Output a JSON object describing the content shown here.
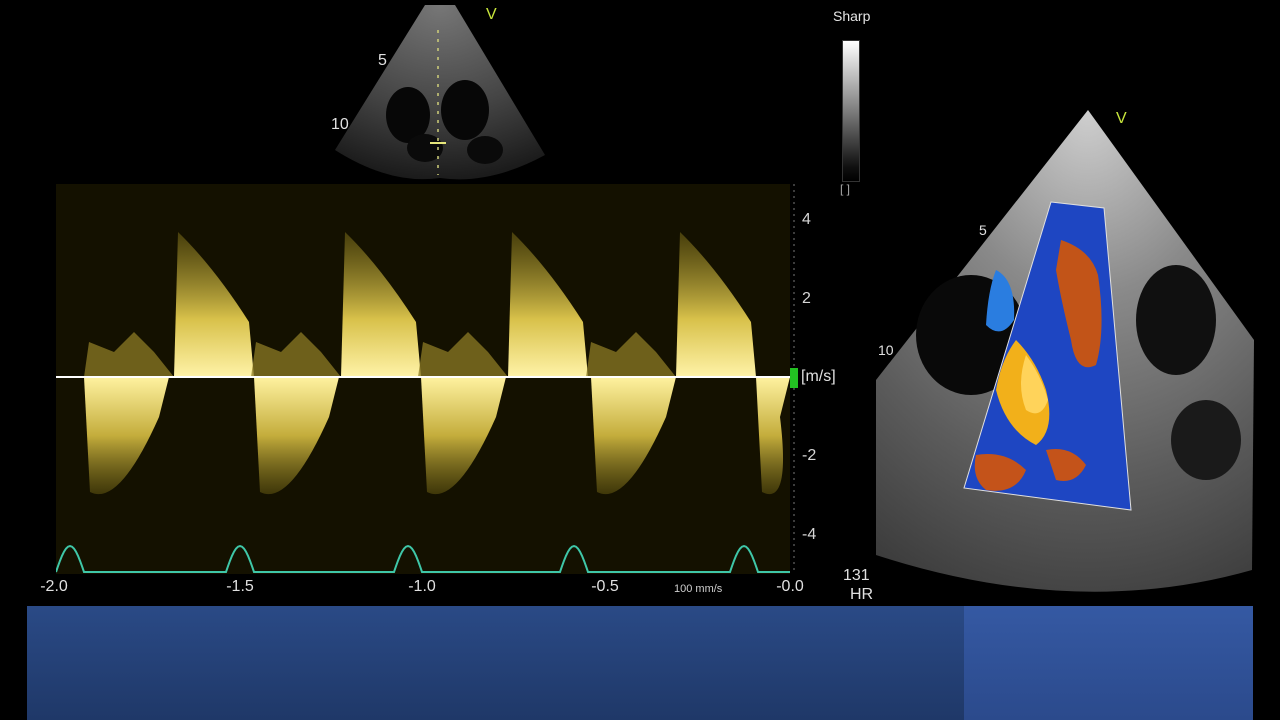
{
  "thumbnail": {
    "depth_marks": [
      "5",
      "10"
    ],
    "orientation_mark": "V"
  },
  "grayscale": {
    "label": "Sharp",
    "bracket": "[ ]"
  },
  "doppler": {
    "velocity_ticks": [
      "4",
      "2",
      "-2",
      "-4"
    ],
    "unit_label": "[m/s]",
    "time_ticks": [
      "-2.0",
      "-1.5",
      "-1.0",
      "-0.5",
      "-0.0"
    ],
    "sweep_speed": "100 mm/s",
    "heart_rate_value": "131",
    "heart_rate_label": "HR",
    "colors": {
      "spectrum": "#f0d85a",
      "ecg": "#3fc7a8",
      "baseline": "#ffffff"
    }
  },
  "color_doppler": {
    "depth_marks": [
      "5",
      "10"
    ],
    "orientation_mark": "V",
    "colors": {
      "toward": "#d0581c",
      "away": "#1d52d8",
      "aliased": "#f3b21b"
    }
  }
}
